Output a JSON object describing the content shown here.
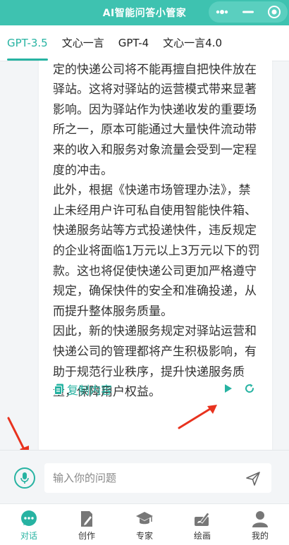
{
  "app": {
    "title": "AI智能问答小管家"
  },
  "window_controls": [
    {
      "icon": "more-dots-icon"
    },
    {
      "icon": "minimize-icon"
    },
    {
      "icon": "close-target-icon"
    }
  ],
  "tabs": [
    {
      "label": "GPT-3.5",
      "active": true
    },
    {
      "label": "文心一言",
      "active": false
    },
    {
      "label": "GPT-4",
      "active": false
    },
    {
      "label": "文心一言4.0",
      "active": false
    }
  ],
  "answer": {
    "text": "新的快递服务规定实施后，需要遵守规定的快递公司将不能再擅自把快件放在驿站。这将对驿站的运营模式带来显著影响。因为驿站作为快递收发的重要场所之一，原本可能通过大量快件流动带来的收入和服务对象流量会受到一定程度的冲击。\n此外，根据《快递市场管理办法》，禁止未经用户许可私自使用智能快件箱、快递服务站等方式投递快件，违反规定的企业将面临1万元以上3万元以下的罚款。这也将促使快递公司更加严格遵守规定，确保快件的安全和准确投递，从而提升整体服务质量。\n因此，新的快递服务规定对驿站运营和快递公司的管理都将产生积极影响，有助于规范行业秩序，提升快递服务质量，保障用户权益。",
    "copy_label": "复制内容"
  },
  "input": {
    "placeholder": "输入你的问题"
  },
  "nav": [
    {
      "label": "对话",
      "icon": "chat-icon",
      "active": true
    },
    {
      "label": "创作",
      "icon": "edit-icon",
      "active": false
    },
    {
      "label": "专家",
      "icon": "graduation-cap-icon",
      "active": false
    },
    {
      "label": "绘画",
      "icon": "paint-icon",
      "active": false
    },
    {
      "label": "我的",
      "icon": "user-icon",
      "active": false
    }
  ],
  "colors": {
    "accent": "#27b3a2",
    "titlebar": "#3ec2b0",
    "annotation_arrow": "#e8321e"
  }
}
